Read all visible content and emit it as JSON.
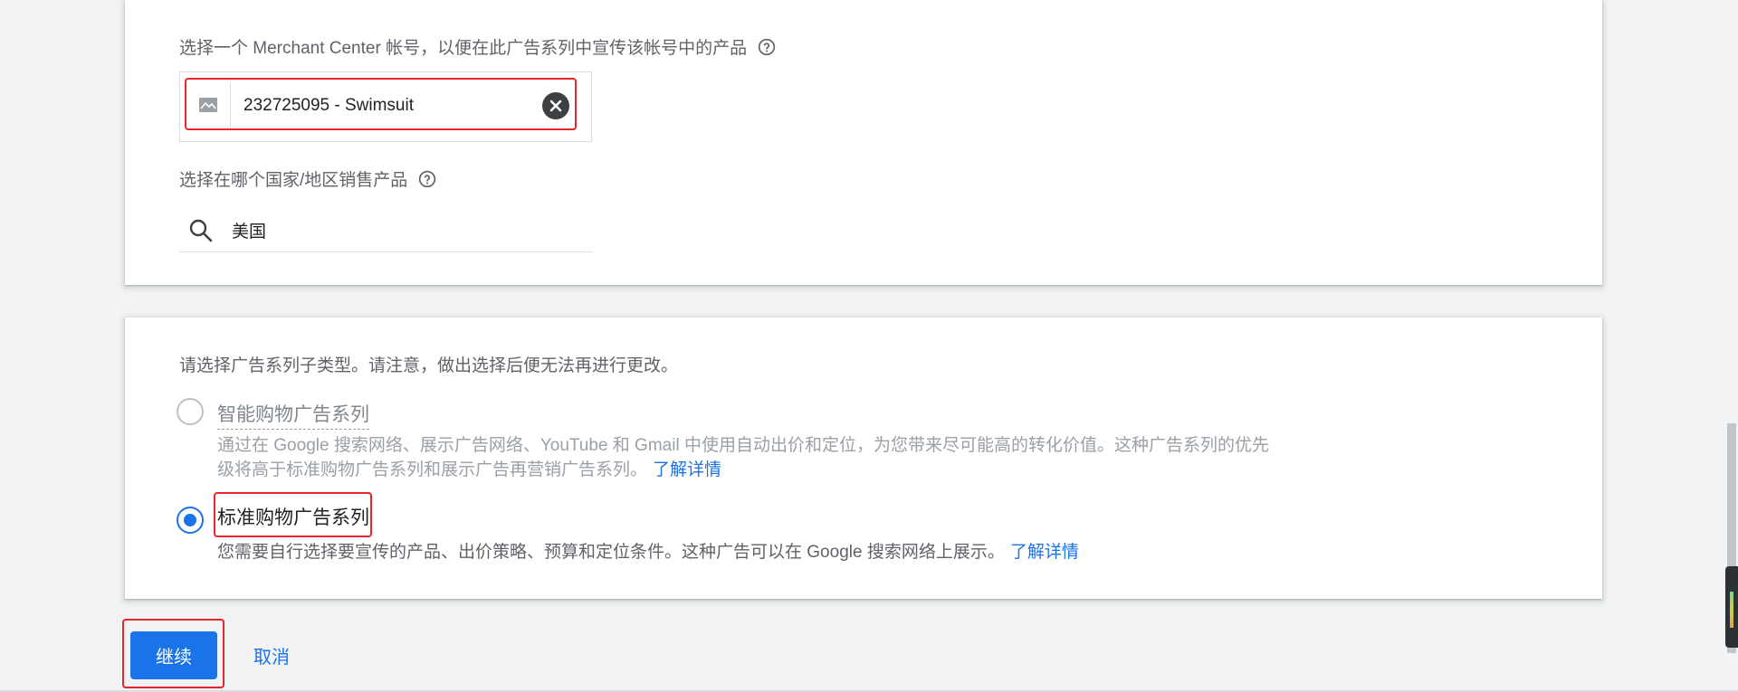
{
  "merchant_section": {
    "label": "选择一个 Merchant Center 帐号，以便在此广告系列中宣传该帐号中的产品",
    "selected_account": "232725095 - Swimsuit"
  },
  "country_section": {
    "label": "选择在哪个国家/地区销售产品",
    "value": "美国"
  },
  "subtype_section": {
    "label": "请选择广告系列子类型。请注意，做出选择后便无法再进行更改。",
    "options": [
      {
        "title": "智能购物广告系列",
        "description": "通过在 Google 搜索网络、展示广告网络、YouTube 和 Gmail 中使用自动出价和定位，为您带来尽可能高的转化价值。这种广告系列的优先级将高于标准购物广告系列和展示广告再营销广告系列。",
        "learn_more": "了解详情",
        "selected": false
      },
      {
        "title": "标准购物广告系列",
        "description": "您需要自行选择要宣传的产品、出价策略、预算和定位条件。这种广告可以在 Google 搜索网络上展示。",
        "learn_more": "了解详情",
        "selected": true
      }
    ]
  },
  "actions": {
    "continue_label": "继续",
    "cancel_label": "取消"
  },
  "icons": {
    "help": "help-circle-icon",
    "clear": "clear-circle-icon",
    "search": "search-icon",
    "merchant_thumb": "image-placeholder-icon"
  },
  "colors": {
    "accent": "#1a73e8",
    "highlight": "#e8252a",
    "background": "#f1f3f4"
  }
}
